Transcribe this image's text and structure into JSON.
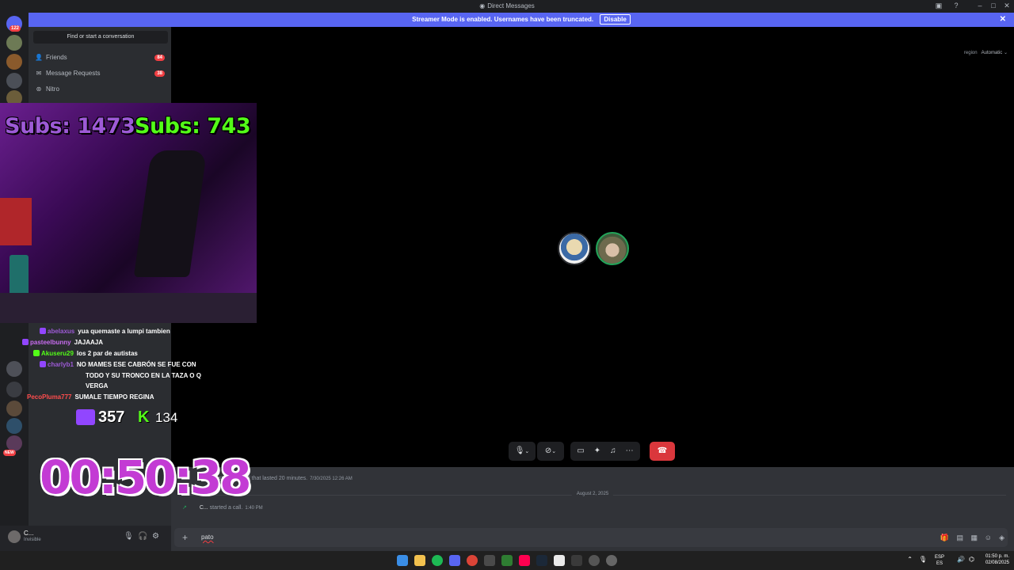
{
  "window": {
    "title": "Direct Messages"
  },
  "banner": {
    "text": "Streamer Mode is enabled. Usernames have been truncated.",
    "button": "Disable"
  },
  "rail": {
    "home_badge": "122"
  },
  "dm_sidebar": {
    "search_placeholder": "Find or start a conversation",
    "nav": [
      {
        "label": "Friends",
        "count": "84",
        "icon": "friends-icon"
      },
      {
        "label": "Message Requests",
        "count": "38",
        "icon": "mail-icon"
      },
      {
        "label": "Nitro",
        "count": "",
        "icon": "nitro-icon"
      }
    ]
  },
  "call": {
    "region_label": "region",
    "region_value": "Automatic"
  },
  "chat": {
    "msg1": "started a call that lasted 20 minutes.",
    "msg1_time": "7/30/2025 12:26 AM",
    "date_divider": "August 2, 2025",
    "msg2_user": "C...",
    "msg2": "started a call.",
    "msg2_time": "1:40 PM"
  },
  "composer": {
    "text": "pato"
  },
  "user_panel": {
    "name": "C...",
    "status": "Invisible"
  },
  "overlay": {
    "subs_left": "Subs: 1473",
    "subs_right": "Subs: 743",
    "chat_lines": [
      {
        "user": "abelaxus",
        "msg": "yua quemaste a lumpi tambien",
        "color": "#9d5ad6"
      },
      {
        "user": "pasteelbunny",
        "msg": "JAJAAJA",
        "color": "#c86cf0"
      },
      {
        "user": "Akuseru29",
        "msg": "los 2 par de autistas",
        "color": "#53fc18"
      },
      {
        "user": "charlyb1",
        "msg": "NO MAMES ESE CABRÓN SE FUE CON",
        "color": "#9d5ad6"
      },
      {
        "user": "",
        "msg": "TODO Y SU TRONCO EN LA TAZA O Q",
        "color": "#ffffff"
      },
      {
        "user": "",
        "msg": "VERGA",
        "color": "#ffffff"
      },
      {
        "user": "PecoPluma777",
        "msg": "SUMALE TIEMPO REGINA",
        "color": "#ff4d4d"
      }
    ],
    "twitch_viewers": "357",
    "kick_viewers": "134",
    "timer": "00:50:38",
    "new_badge": "NEW"
  },
  "taskbar": {
    "lang1": "ESP",
    "lang2": "ES",
    "time": "01:50 p. m.",
    "date": "02/08/2025"
  },
  "colors": {
    "accent": "#5865f2",
    "danger": "#f23f43",
    "kick": "#53fc18",
    "twitch": "#9146ff"
  }
}
